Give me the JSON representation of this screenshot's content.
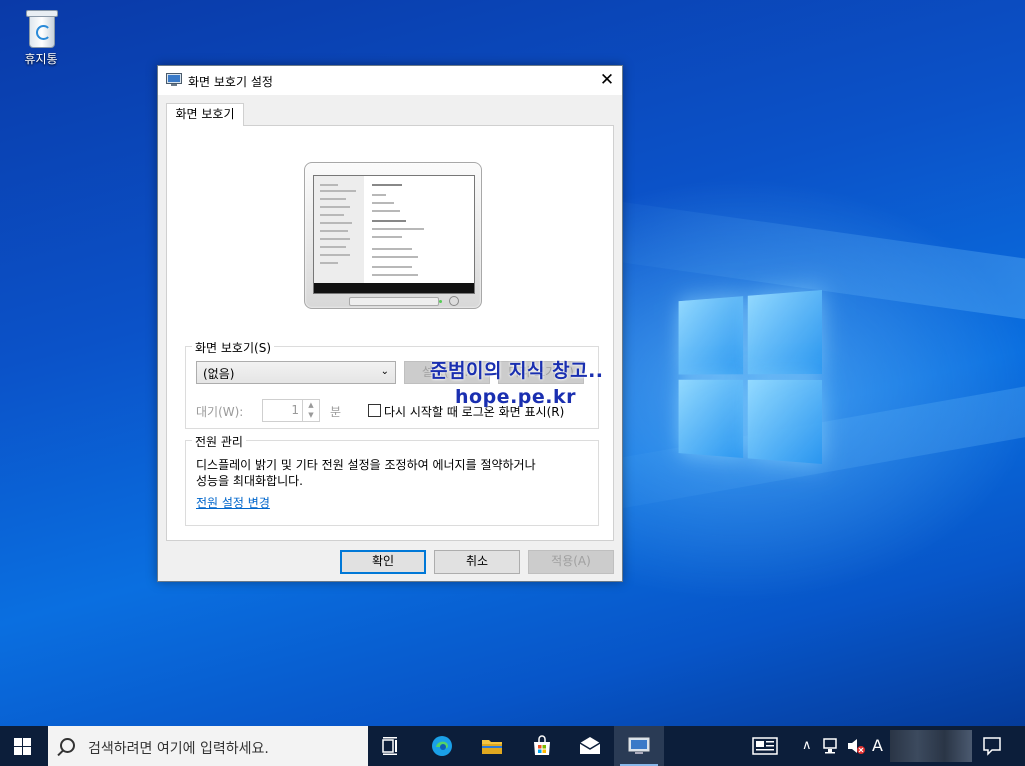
{
  "desktop": {
    "recycle_bin_label": "휴지통"
  },
  "dialog": {
    "title": "화면 보호기 설정",
    "close_glyph": "✕",
    "tab_label": "화면 보호기",
    "screensaver_group": {
      "label": "화면 보호기(S)",
      "selected": "(없음)",
      "settings_button": "설정(T)...",
      "preview_button": "미리 보기(V)",
      "wait_label": "대기(W):",
      "wait_value": "1",
      "wait_unit": "분",
      "resume_checkbox_label": "다시 시작할 때 로그온 화면 표시(R)"
    },
    "power_group": {
      "label": "전원 관리",
      "description_line1": "디스플레이 밝기 및 기타 전원 설정을 조정하여 에너지를 절약하거나",
      "description_line2": "성능을 최대화합니다.",
      "link": "전원 설정 변경"
    },
    "ok_button": "확인",
    "cancel_button": "취소",
    "apply_button": "적용(A)"
  },
  "watermark": {
    "line1": "준범이의 지식 창고..",
    "line2": "hope.pe.kr"
  },
  "taskbar": {
    "search_placeholder": "검색하려면 여기에 입력하세요.",
    "input_indicator": "A"
  },
  "colors": {
    "accent": "#0078d7",
    "link": "#0066cc",
    "taskbar": "#0c1e3a"
  }
}
